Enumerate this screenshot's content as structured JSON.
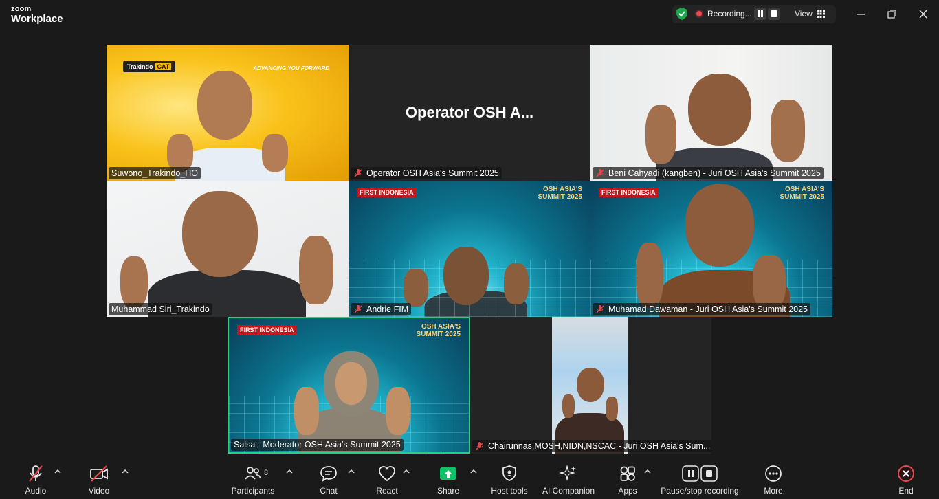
{
  "app": {
    "brand_top": "zoom",
    "brand_bottom": "Workplace"
  },
  "recording": {
    "status": "Recording...",
    "view_label": "View"
  },
  "tiles": {
    "t1": {
      "name": "Suwono_Trakindo_HO",
      "brand": "Trakindo",
      "brand_mark": "CAT",
      "tagline": "ADVANCING YOU FORWARD"
    },
    "t2": {
      "name": "Operator OSH Asia's Summit 2025",
      "display": "Operator OSH A..."
    },
    "t3": {
      "name": "Beni Cahyadi (kangben) - Juri OSH Asia's Summit 2025"
    },
    "t4": {
      "name": "Muhammad Siri_Trakindo"
    },
    "t5": {
      "name": "Andrie FIM",
      "logo": "FIRST INDONESIA",
      "event": "OSH ASIA'S SUMMIT 2025"
    },
    "t6": {
      "name": "Muhamad Dawaman - Juri OSH Asia's Summit 2025",
      "logo": "FIRST INDONESIA",
      "event": "OSH ASIA'S SUMMIT 2025"
    },
    "t7": {
      "name": "Salsa - Moderator OSH Asia's Summit 2025",
      "logo": "FIRST INDONESIA",
      "event": "OSH ASIA'S SUMMIT 2025"
    },
    "t8": {
      "name": "Chairunnas,MOSH,NIDN,NSCAC - Juri OSH Asia's Sum..."
    }
  },
  "toolbar": {
    "audio": "Audio",
    "video": "Video",
    "participants": "Participants",
    "participants_count": "8",
    "chat": "Chat",
    "react": "React",
    "share": "Share",
    "host_tools": "Host tools",
    "ai_companion": "AI Companion",
    "apps": "Apps",
    "pause_stop": "Pause/stop recording",
    "more": "More",
    "end": "End"
  },
  "colors": {
    "active_speaker": "#23d18b",
    "recording": "#e5484d",
    "share": "#0fc267",
    "end": "#e5484d"
  }
}
